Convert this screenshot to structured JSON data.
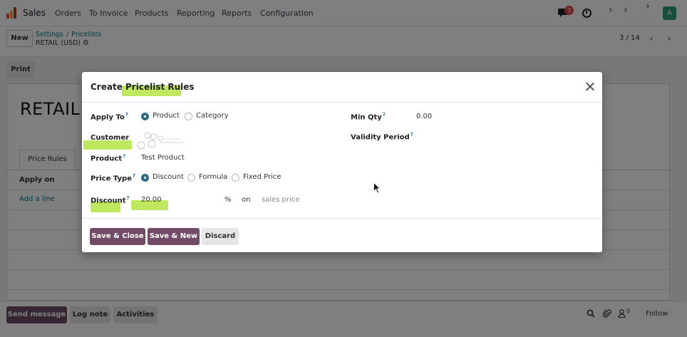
{
  "topnav": {
    "app_name": "Sales",
    "menu": [
      "Orders",
      "To Invoice",
      "Products",
      "Reporting",
      "Reports",
      "Configuration"
    ],
    "chat_badge": "3",
    "avatar_letter": "A"
  },
  "control_panel": {
    "new_label": "New",
    "breadcrumb": [
      "Settings",
      "Pricelists"
    ],
    "record_name": "RETAIL (USD)",
    "pager": "3 / 14"
  },
  "form": {
    "print_label": "Print",
    "title": "RETAIL",
    "tab_label": "Price Rules",
    "column_header": "Apply on",
    "add_line": "Add a line"
  },
  "chatter": {
    "send_message": "Send message",
    "log_note": "Log note",
    "activities": "Activities",
    "followers_count": "0",
    "follow": "Follow"
  },
  "dialog": {
    "title": "Create Pricelist Rules",
    "help_marker": "?",
    "apply_to": {
      "label": "Apply To",
      "options": [
        "Product",
        "Category"
      ],
      "selected": "Product"
    },
    "customer": {
      "label": "Customer"
    },
    "product": {
      "label": "Product",
      "value": "Test Product"
    },
    "price_type": {
      "label": "Price Type",
      "options": [
        "Discount",
        "Formula",
        "Fixed Price"
      ],
      "selected": "Discount"
    },
    "discount": {
      "label": "Discount",
      "value": "20.00",
      "unit": "%",
      "on": "on",
      "base": "sales price"
    },
    "min_qty": {
      "label": "Min Qty",
      "value": "0.00"
    },
    "validity_period": {
      "label": "Validity Period"
    },
    "buttons": {
      "save_close": "Save & Close",
      "save_new": "Save & New",
      "discard": "Discard"
    }
  },
  "colors": {
    "primary": "#714b67",
    "link": "#017e84",
    "radio_selected": "#2e6d85",
    "highlight": "#b9e64e"
  }
}
